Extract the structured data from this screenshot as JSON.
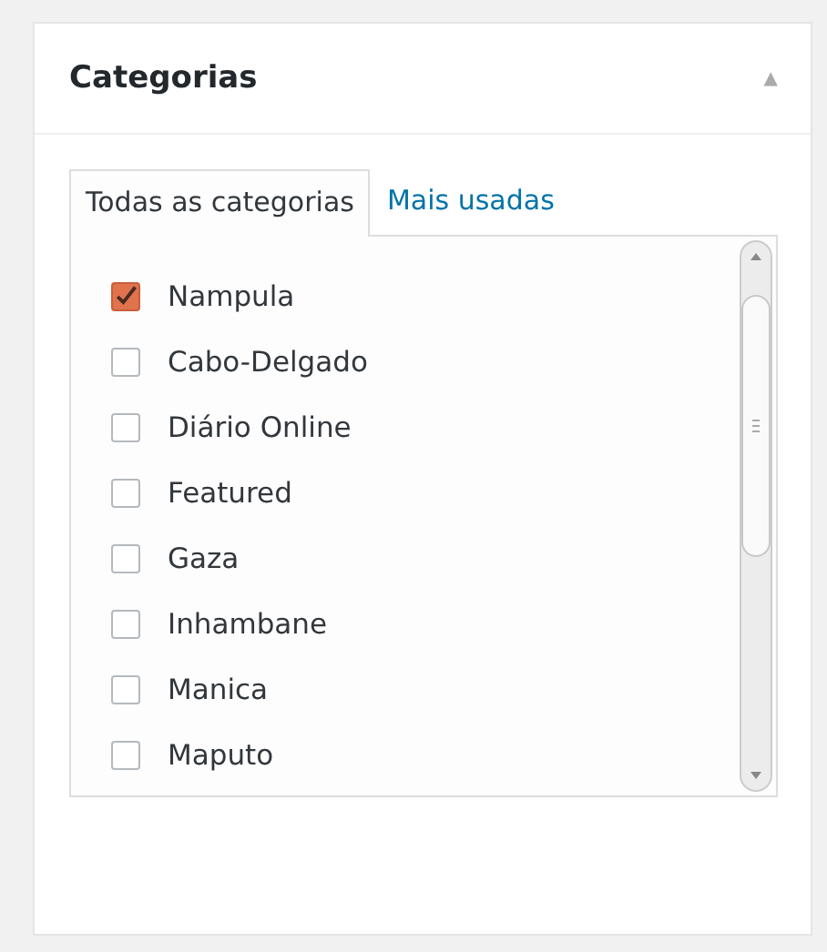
{
  "panel": {
    "title": "Categorias",
    "collapse_icon": "▲"
  },
  "tabs": [
    {
      "label": "Todas as categorias",
      "selected": true
    },
    {
      "label": "Mais usadas",
      "selected": false
    }
  ],
  "categories": [
    {
      "label": "Nampula",
      "checked": true
    },
    {
      "label": "Cabo-Delgado",
      "checked": false
    },
    {
      "label": "Diário Online",
      "checked": false
    },
    {
      "label": "Featured",
      "checked": false
    },
    {
      "label": "Gaza",
      "checked": false
    },
    {
      "label": "Inhambane",
      "checked": false
    },
    {
      "label": "Manica",
      "checked": false
    },
    {
      "label": "Maputo",
      "checked": false
    }
  ]
}
